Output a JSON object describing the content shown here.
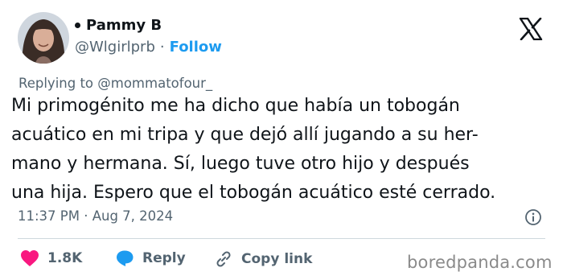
{
  "author": {
    "display_name": "Pammy B",
    "handle": "@Wlgirlprb",
    "separator": "·",
    "follow_label": "Follow"
  },
  "reply_context": "Replying to @mommatofour_",
  "tweet_lines": [
    "Mi primogénito me ha dicho que había un tobogán",
    "acuático en mi tripa y que dejó allí jugando a su her-",
    "mano y hermana. Sí, luego tuve otro hijo y después",
    "una hija. Espero que el tobogán acuático esté cerrado."
  ],
  "timestamp": "11:37 PM · Aug 7, 2024",
  "actions": {
    "like_count": "1.8K",
    "reply_label": "Reply",
    "copy_label": "Copy link"
  },
  "watermark": "boredpanda.com",
  "colors": {
    "like": "#f91880",
    "link": "#1d9bf0",
    "reply_icon": "#1d9bf0",
    "muted": "#536471"
  },
  "icons": [
    "x-logo-icon",
    "info-icon",
    "heart-icon",
    "reply-bubble-icon",
    "link-icon"
  ]
}
